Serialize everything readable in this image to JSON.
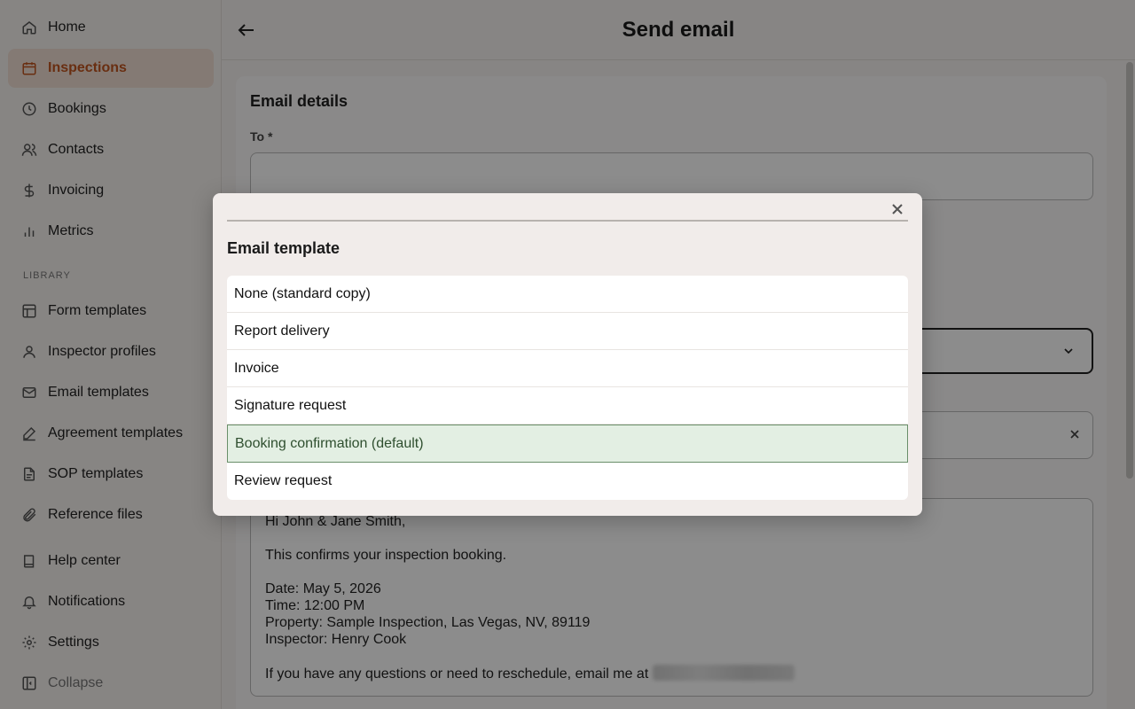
{
  "sidebar": {
    "items": [
      {
        "label": "Home",
        "icon": "home-icon"
      },
      {
        "label": "Inspections",
        "icon": "calendar-icon"
      },
      {
        "label": "Bookings",
        "icon": "clock-icon"
      },
      {
        "label": "Contacts",
        "icon": "users-icon"
      },
      {
        "label": "Invoicing",
        "icon": "dollar-icon"
      },
      {
        "label": "Metrics",
        "icon": "bar-chart-icon"
      }
    ],
    "library_label": "LIBRARY",
    "library_items": [
      {
        "label": "Form templates",
        "icon": "layout-icon"
      },
      {
        "label": "Inspector profiles",
        "icon": "user-icon"
      },
      {
        "label": "Email templates",
        "icon": "mail-icon"
      },
      {
        "label": "Agreement templates",
        "icon": "signature-icon"
      },
      {
        "label": "SOP templates",
        "icon": "document-icon"
      },
      {
        "label": "Reference files",
        "icon": "paperclip-icon"
      }
    ],
    "bottom_items": [
      {
        "label": "Help center",
        "icon": "book-icon"
      },
      {
        "label": "Notifications",
        "icon": "bell-icon"
      },
      {
        "label": "Settings",
        "icon": "gear-icon"
      },
      {
        "label": "Collapse",
        "icon": "collapse-icon"
      }
    ],
    "active_color": "#c0551f"
  },
  "header": {
    "title": "Send email"
  },
  "form": {
    "section_title": "Email details",
    "to_label": "To *",
    "body_lines": [
      "Hi John & Jane Smith,",
      "This confirms your inspection booking.",
      "Date: May 5, 2026",
      "Time: 12:00 PM",
      "Property: Sample Inspection, Las Vegas, NV, 89119",
      "Inspector: Henry Cook",
      "If you have any questions or need to reschedule, email me at "
    ]
  },
  "modal": {
    "title": "Email template",
    "options": [
      {
        "label": "None (standard copy)",
        "selected": false
      },
      {
        "label": "Report delivery",
        "selected": false
      },
      {
        "label": "Invoice",
        "selected": false
      },
      {
        "label": "Signature request",
        "selected": false
      },
      {
        "label": "Booking confirmation (default)",
        "selected": true
      },
      {
        "label": "Review request",
        "selected": false
      }
    ],
    "selected_color": "#e3efe3"
  }
}
